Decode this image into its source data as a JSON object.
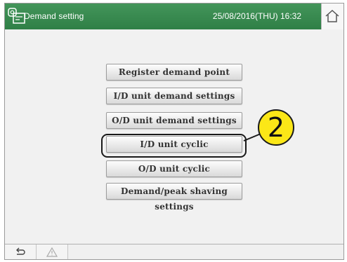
{
  "header": {
    "title": "Demand setting",
    "datetime": "25/08/2016(THU) 16:32",
    "app_icon": "demand-app-icon",
    "home_icon": "home-icon"
  },
  "menu": {
    "items": [
      {
        "label": "Register demand point"
      },
      {
        "label": "I/D unit demand settings"
      },
      {
        "label": "O/D unit demand settings"
      },
      {
        "label": "I/D unit cyclic"
      },
      {
        "label": "O/D unit cyclic"
      },
      {
        "label": "Demand/peak shaving settings"
      }
    ]
  },
  "callout": {
    "number": "2",
    "color": "#fbe717"
  },
  "footer": {
    "back_icon": "back-icon",
    "warning_icon": "warning-icon"
  },
  "colors": {
    "titlebar": "#2f7f46",
    "background": "#f1f1f1"
  }
}
